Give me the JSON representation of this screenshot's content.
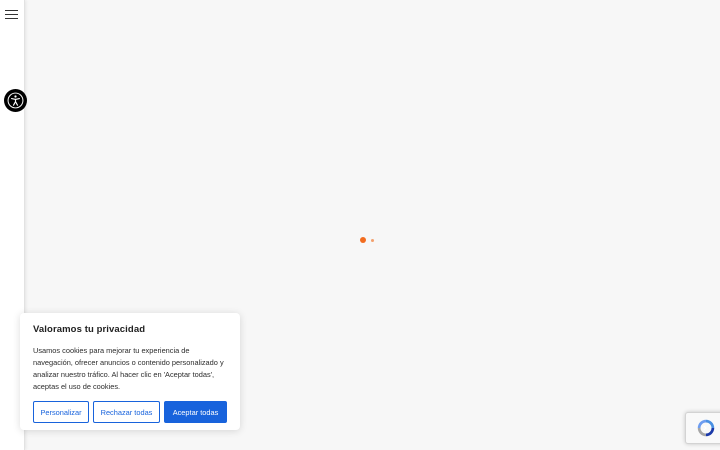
{
  "sidebar": {
    "menu_icon": "hamburger-menu-icon",
    "accessibility_icon": "accessibility-person-icon"
  },
  "loader": {
    "colors": [
      "#f26c1f",
      "#f3a06d"
    ]
  },
  "cookie_banner": {
    "title": "Valoramos tu privacidad",
    "text": "Usamos cookies para mejorar tu experiencia de navegación, ofrecer anuncios o contenido personalizado y analizar nuestro tráfico. Al hacer clic en 'Aceptar todas', aceptas el uso de cookies.",
    "buttons": {
      "customize": "Personalizar",
      "reject": "Rechazar todas",
      "accept": "Aceptar todas"
    },
    "accent_color": "#1863dc"
  },
  "recaptcha": {
    "icon": "recaptcha-logo-icon"
  }
}
